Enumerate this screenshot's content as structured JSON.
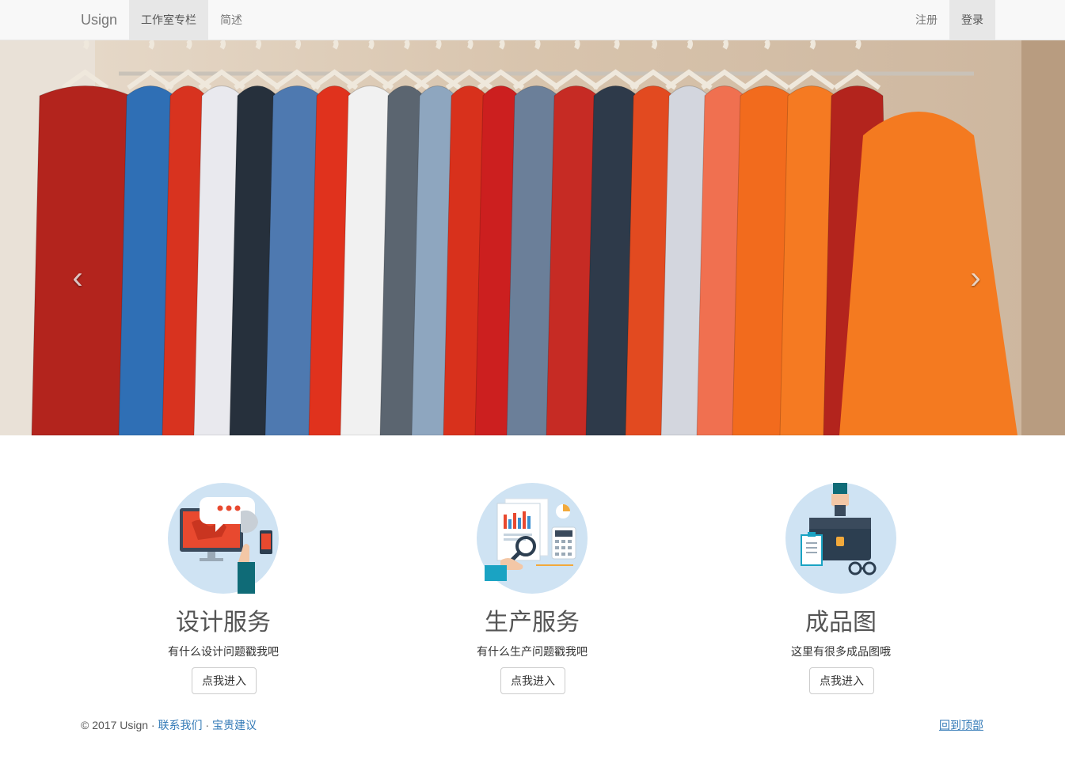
{
  "navbar": {
    "brand": "Usign",
    "left_items": [
      {
        "label": "工作室专栏",
        "active": true
      },
      {
        "label": "简述",
        "active": false
      }
    ],
    "right_items": [
      {
        "label": "注册",
        "active": false
      },
      {
        "label": "登录",
        "active": true
      }
    ]
  },
  "carousel": {
    "prev_icon": "chevron-left-icon",
    "next_icon": "chevron-right-icon",
    "prev_glyph": "‹",
    "next_glyph": "›",
    "slide_count": 3,
    "active_slide": 1,
    "image_subject": "clothes-rack"
  },
  "features": [
    {
      "icon": "design-service-icon",
      "title": "设计服务",
      "desc": "有什么设计问题戳我吧",
      "button": "点我进入"
    },
    {
      "icon": "production-service-icon",
      "title": "生产服务",
      "desc": "有什么生产问题戳我吧",
      "button": "点我进入"
    },
    {
      "icon": "products-gallery-icon",
      "title": "成品图",
      "desc": "这里有很多成品图哦",
      "button": "点我进入"
    }
  ],
  "footer": {
    "copyright": "© 2017 Usign",
    "sep": " · ",
    "links": [
      "联系我们",
      "宝贵建议"
    ],
    "back_to_top": "回到顶部"
  },
  "colors": {
    "link": "#337ab7",
    "navbar_bg": "#f8f8f8",
    "icon_circle": "#cfe3f3"
  }
}
